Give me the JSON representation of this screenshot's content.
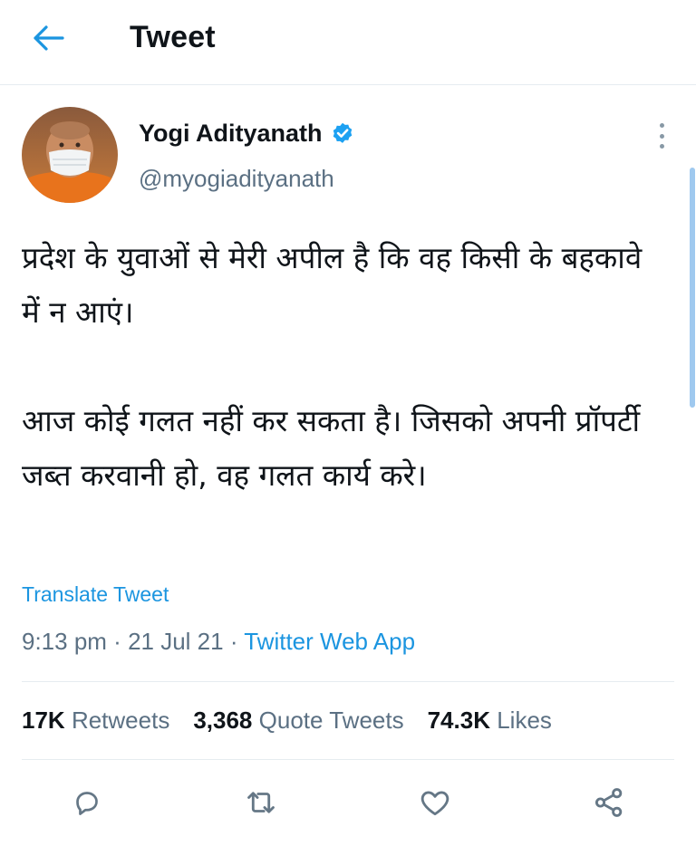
{
  "header": {
    "title": "Tweet"
  },
  "author": {
    "name": "Yogi Adityanath",
    "handle": "@myogiadityanath"
  },
  "tweet": {
    "paragraph_1": "प्रदेश के युवाओं से मेरी अपील है कि वह किसी के बहकावे में न आएं।",
    "paragraph_2": "आज कोई गलत नहीं कर सकता है। जिसको अपनी प्रॉपर्टी जब्त करवानी हो, वह गलत कार्य करे।",
    "translate_label": "Translate Tweet"
  },
  "meta": {
    "time": "9:13 pm",
    "separator": " · ",
    "date": "21 Jul 21",
    "source": "Twitter Web App"
  },
  "stats": {
    "retweets_count": "17K",
    "retweets_label": "Retweets",
    "quotes_count": "3,368",
    "quotes_label": "Quote Tweets",
    "likes_count": "74.3K",
    "likes_label": "Likes"
  },
  "colors": {
    "accent": "#1b95e0",
    "secondary_text": "#5b7083",
    "verified": "#1da1f2"
  },
  "icons": {
    "back": "arrow-left-icon",
    "verified": "verified-badge-icon",
    "more": "more-vertical-icon",
    "reply": "reply-icon",
    "retweet": "retweet-icon",
    "like": "heart-icon",
    "share": "share-icon"
  }
}
